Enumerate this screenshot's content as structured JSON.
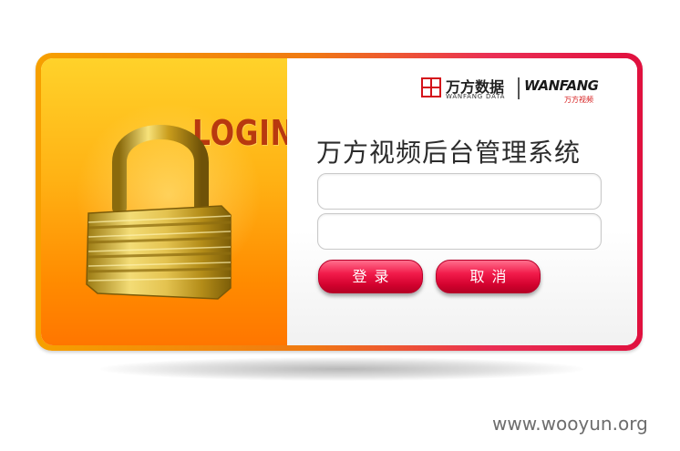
{
  "left_panel": {
    "login_text": "LOGIN",
    "icon": "padlock-icon"
  },
  "brand": {
    "logo_icon": "wanfang-logo-icon",
    "name_cn": "万方数据",
    "name_en": "WANFANG DATA",
    "video_name": "WANFANG",
    "video_name_cn": "万方视频"
  },
  "form": {
    "title": "万方视频后台管理系统",
    "username_value": "",
    "password_value": "",
    "login_label": "登录",
    "cancel_label": "取消"
  },
  "colors": {
    "frame_orange": "#f6a000",
    "frame_red": "#e0103e",
    "button_red": "#d4022f",
    "login_text": "#b8390f"
  },
  "watermark": "www.wooyun.org"
}
